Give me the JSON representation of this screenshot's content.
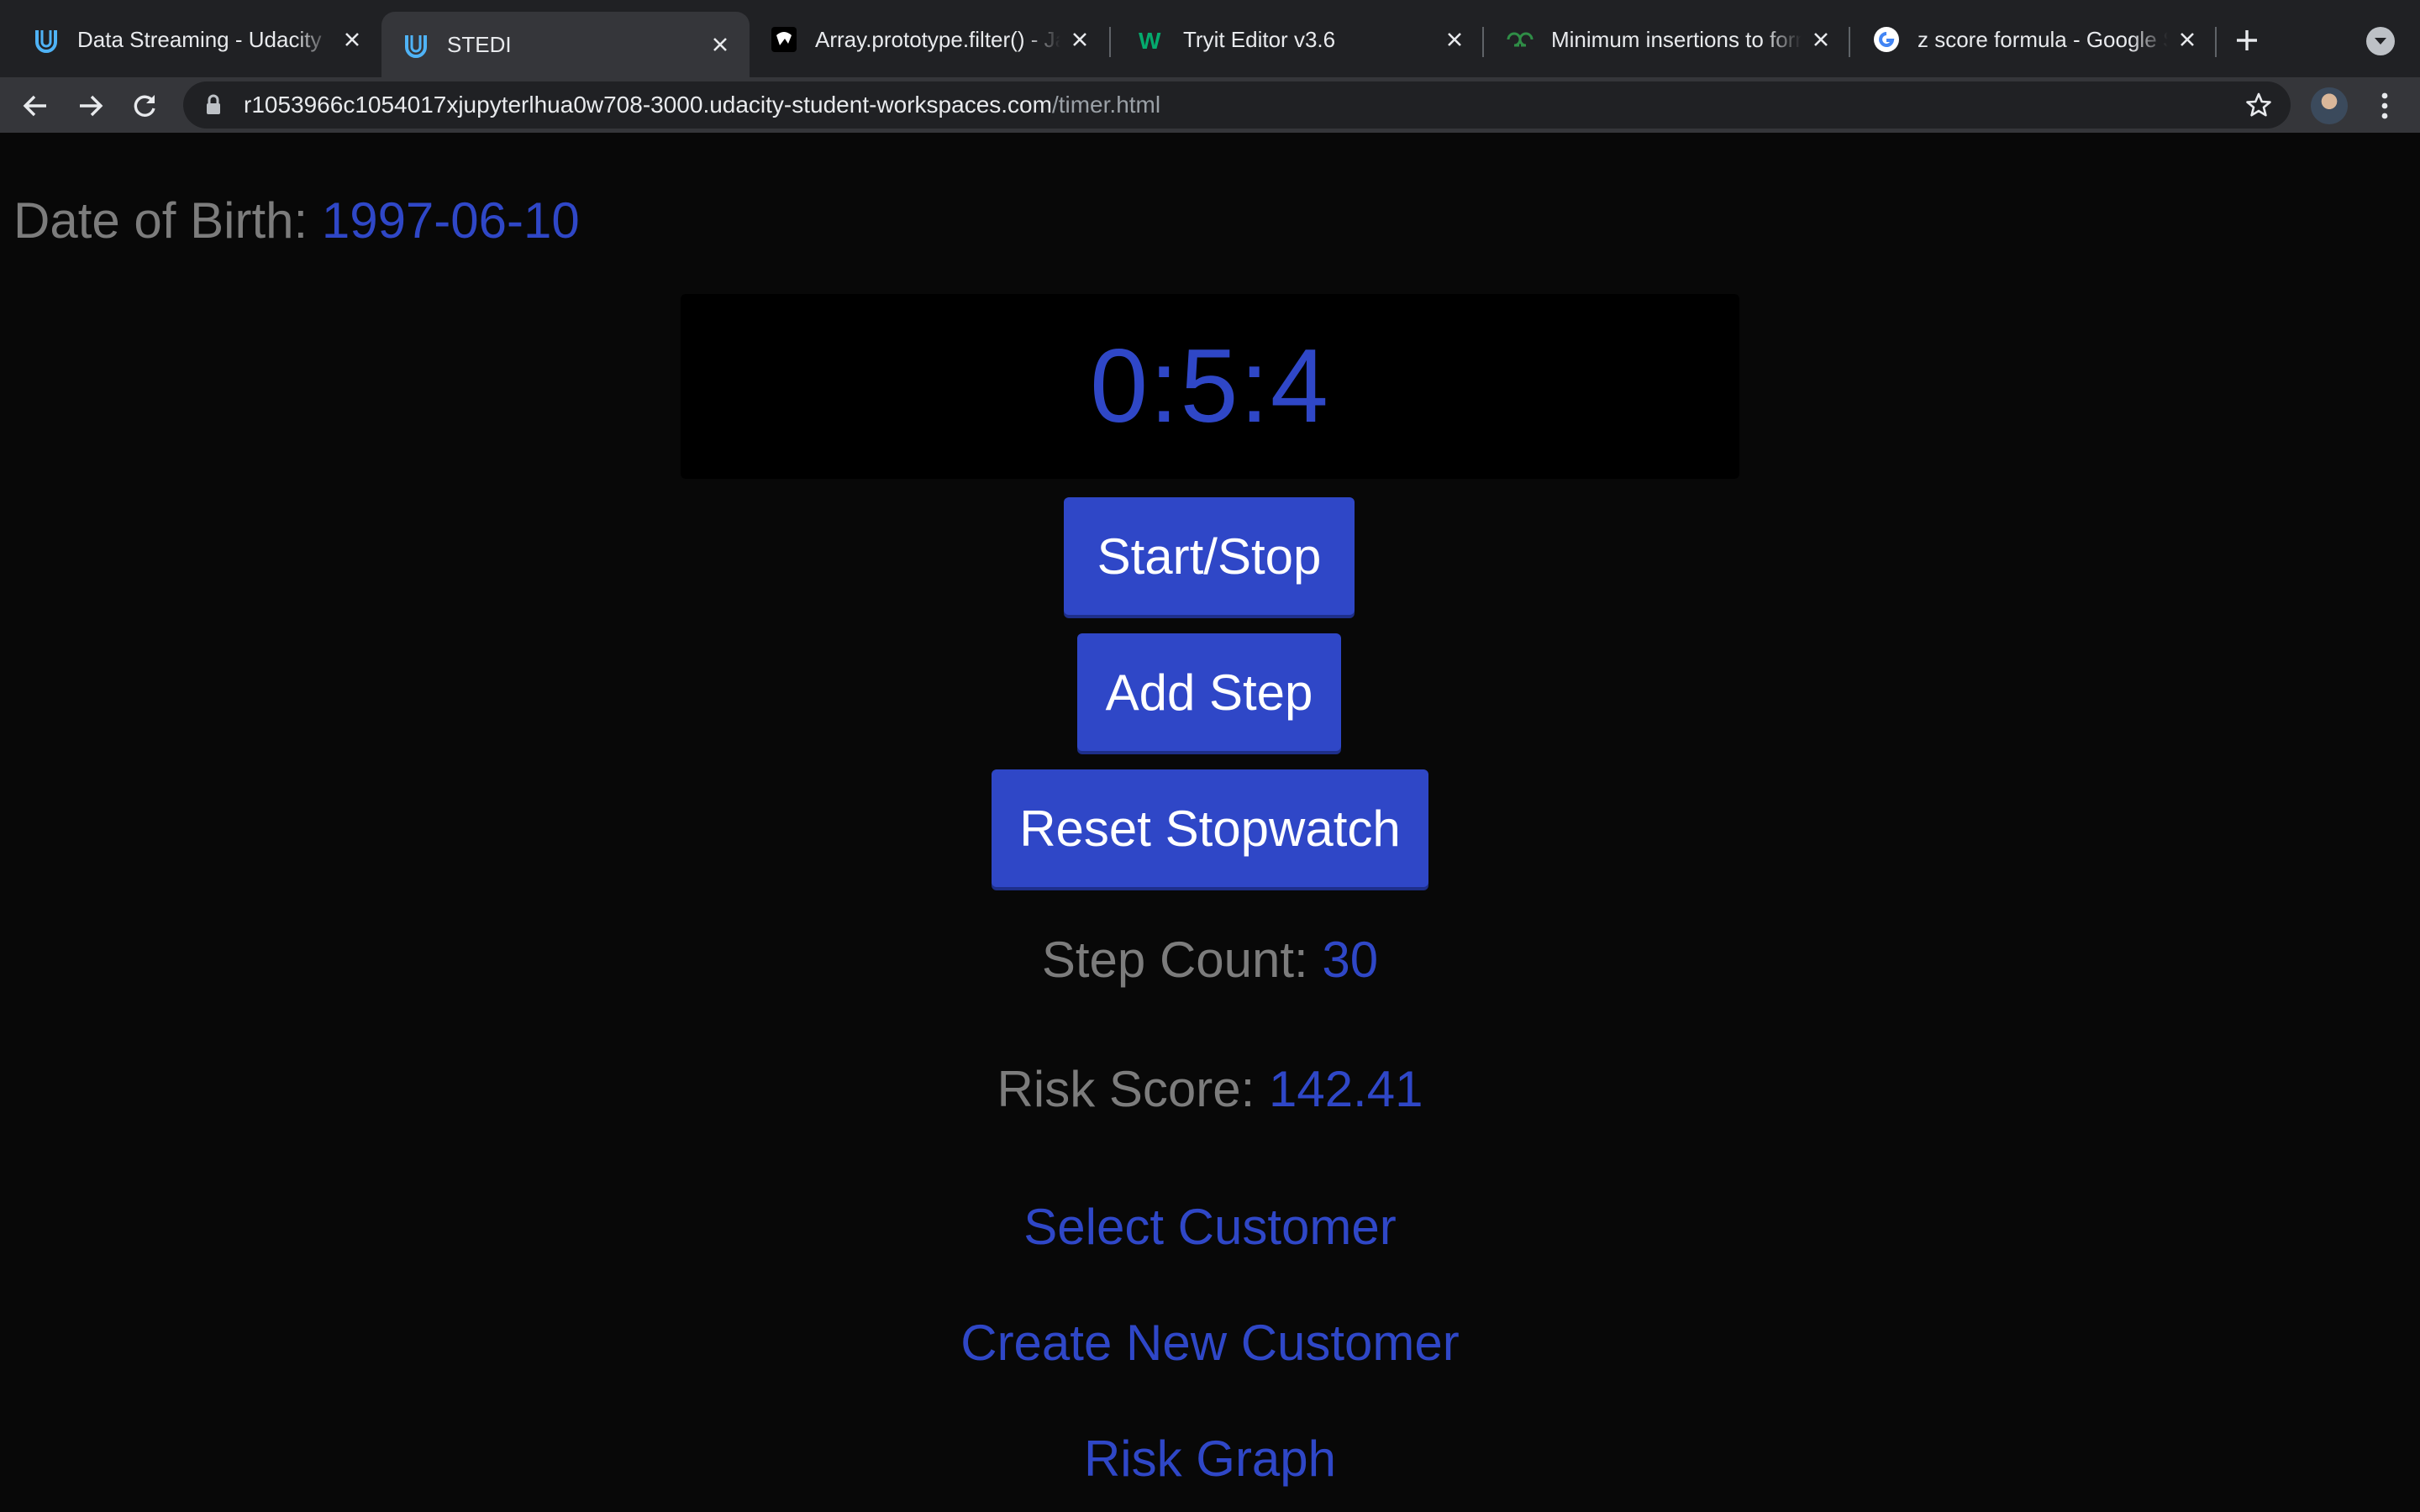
{
  "browser": {
    "tabs": [
      {
        "title": "Data Streaming - Udacity",
        "icon": "udacity-icon",
        "active": false
      },
      {
        "title": "STEDI",
        "icon": "udacity-icon",
        "active": true
      },
      {
        "title": "Array.prototype.filter() - JavaScript | MDN",
        "icon": "mdn-icon",
        "active": false
      },
      {
        "title": "Tryit Editor v3.6",
        "icon": "w3schools-icon",
        "active": false
      },
      {
        "title": "Minimum insertions to form a palindrome",
        "icon": "geeksforgeeks-icon",
        "active": false
      },
      {
        "title": "z score formula - Google Search",
        "icon": "google-icon",
        "active": false
      }
    ],
    "url_host": "r1053966c1054017xjupyterlhua0w708-3000.udacity-student-workspaces.com",
    "url_path": "/timer.html"
  },
  "page": {
    "dob_label": "Date of Birth:",
    "dob_value": "1997-06-10",
    "timer": "0:5:4",
    "buttons": {
      "start_stop": "Start/Stop",
      "add_step": "Add Step",
      "reset": "Reset Stopwatch"
    },
    "step_count_label": "Step Count:",
    "step_count_value": "30",
    "risk_score_label": "Risk Score:",
    "risk_score_value": "142.41",
    "links": {
      "select_customer": "Select Customer",
      "create_customer": "Create New Customer",
      "risk_graph": "Risk Graph"
    }
  },
  "colors": {
    "accent": "#2f47c7",
    "label_gray": "#7c7c7c",
    "background": "#080808"
  }
}
